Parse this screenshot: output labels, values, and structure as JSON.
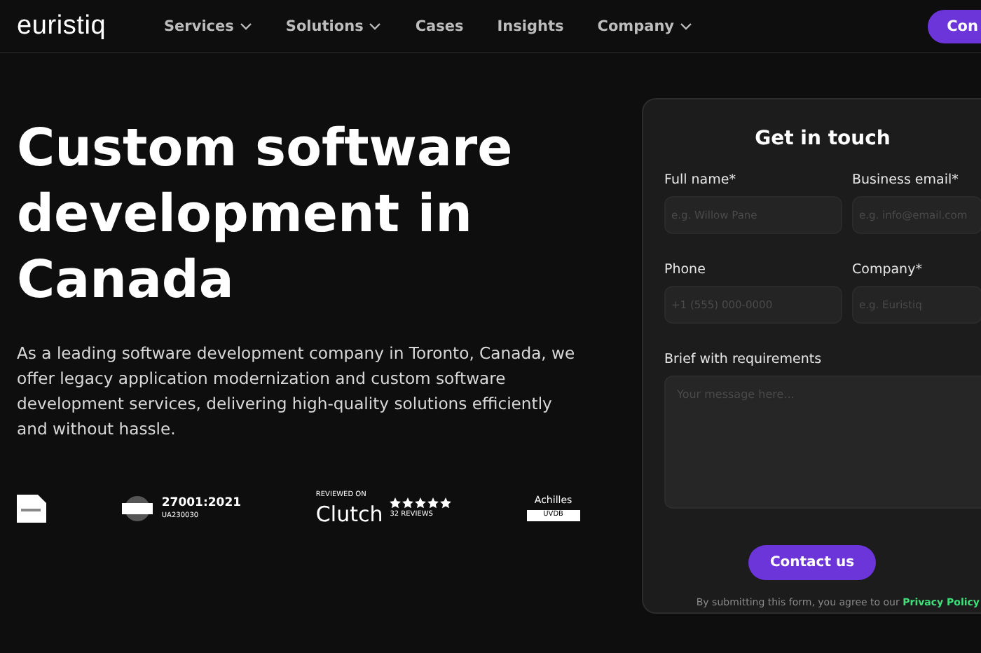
{
  "header": {
    "logo": "euristiq",
    "nav": [
      {
        "label": "Services",
        "dropdown": true
      },
      {
        "label": "Solutions",
        "dropdown": true
      },
      {
        "label": "Cases",
        "dropdown": false
      },
      {
        "label": "Insights",
        "dropdown": false
      },
      {
        "label": "Company",
        "dropdown": true
      }
    ],
    "cta": "Con"
  },
  "hero": {
    "title": "Custom software development in Canada",
    "description": "As a leading software development company in Toronto, Canada, we offer legacy application modernization and custom software development services, delivering high-quality solutions efficiently and without hassle."
  },
  "badges": [
    {
      "kind": "partner"
    },
    {
      "kind": "iso",
      "title": "27001:2021",
      "code": "UA230030"
    },
    {
      "kind": "clutch",
      "caption": "REVIEWED ON",
      "name": "Clutch",
      "stars": 5,
      "reviews": "32 REVIEWS"
    },
    {
      "kind": "achilles",
      "name": "Achilles",
      "label": "UVDB"
    }
  ],
  "form": {
    "title": "Get in touch",
    "fields": [
      {
        "label": "Full name*",
        "placeholder": "e.g. Willow Pane"
      },
      {
        "label": "Business email*",
        "placeholder": "e.g. info@email.com"
      },
      {
        "label": "Phone",
        "placeholder": "+1 (555) 000-0000"
      },
      {
        "label": "Company*",
        "placeholder": "e.g. Euristiq"
      }
    ],
    "message": {
      "label": "Brief with requirements",
      "placeholder": "Your message here..."
    },
    "submit": "Contact us",
    "consent": "By submitting this form, you agree to our",
    "policy_link": "Privacy Policy"
  }
}
